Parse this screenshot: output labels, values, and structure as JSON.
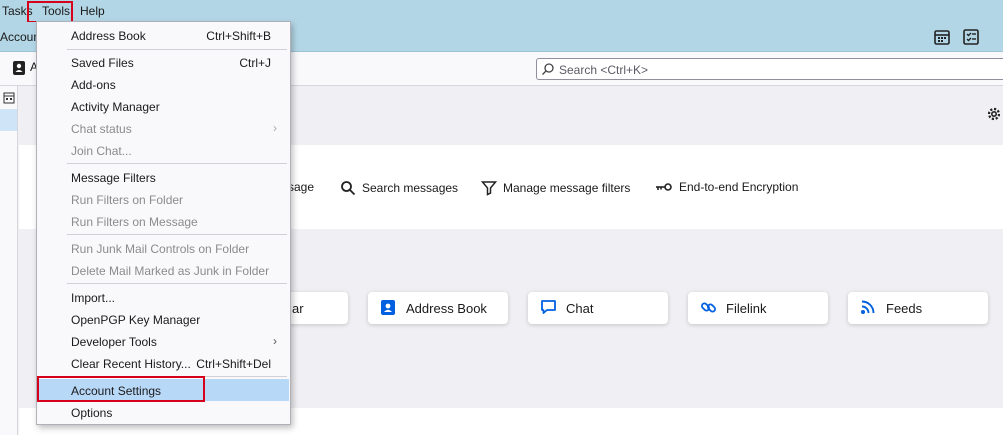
{
  "menubar": {
    "tasks": "Tasks",
    "tools": "Tools",
    "help": "Help"
  },
  "toolbar": {
    "accounts": "Accoun"
  },
  "tab": {
    "label": "A"
  },
  "search": {
    "placeholder": "Search <Ctrl+K>"
  },
  "actions": [
    {
      "label": "sage",
      "icon": "write-icon"
    },
    {
      "label": "Search messages",
      "icon": "search-icon"
    },
    {
      "label": "Manage message filters",
      "icon": "filter-icon"
    },
    {
      "label": "End-to-end Encryption",
      "icon": "key-icon"
    }
  ],
  "cards": [
    {
      "label": "ar",
      "icon": "calendar-icon"
    },
    {
      "label": "Address Book",
      "icon": "address-book-icon"
    },
    {
      "label": "Chat",
      "icon": "chat-icon"
    },
    {
      "label": "Filelink",
      "icon": "link-icon"
    },
    {
      "label": "Feeds",
      "icon": "rss-icon"
    }
  ],
  "menu": {
    "items": [
      {
        "label": "Address Book",
        "shortcut": "Ctrl+Shift+B"
      },
      {
        "label": "Saved Files",
        "shortcut": "Ctrl+J"
      },
      {
        "label": "Add-ons",
        "shortcut": ""
      },
      {
        "label": "Activity Manager",
        "shortcut": ""
      },
      {
        "label": "Chat status",
        "shortcut": ""
      },
      {
        "label": "Join Chat...",
        "shortcut": ""
      },
      {
        "label": "Message Filters",
        "shortcut": ""
      },
      {
        "label": "Run Filters on Folder",
        "shortcut": ""
      },
      {
        "label": "Run Filters on Message",
        "shortcut": ""
      },
      {
        "label": "Run Junk Mail Controls on Folder",
        "shortcut": ""
      },
      {
        "label": "Delete Mail Marked as Junk in Folder",
        "shortcut": ""
      },
      {
        "label": "Import...",
        "shortcut": ""
      },
      {
        "label": "OpenPGP Key Manager",
        "shortcut": ""
      },
      {
        "label": "Developer Tools",
        "shortcut": ""
      },
      {
        "label": "Clear Recent History...",
        "shortcut": "Ctrl+Shift+Del"
      },
      {
        "label": "Account Settings",
        "shortcut": ""
      },
      {
        "label": "Options",
        "shortcut": ""
      }
    ]
  },
  "colors": {
    "highlight": "#b8d8f8",
    "annotation": "#d6001c",
    "toolbar": "#b3d6e6"
  }
}
